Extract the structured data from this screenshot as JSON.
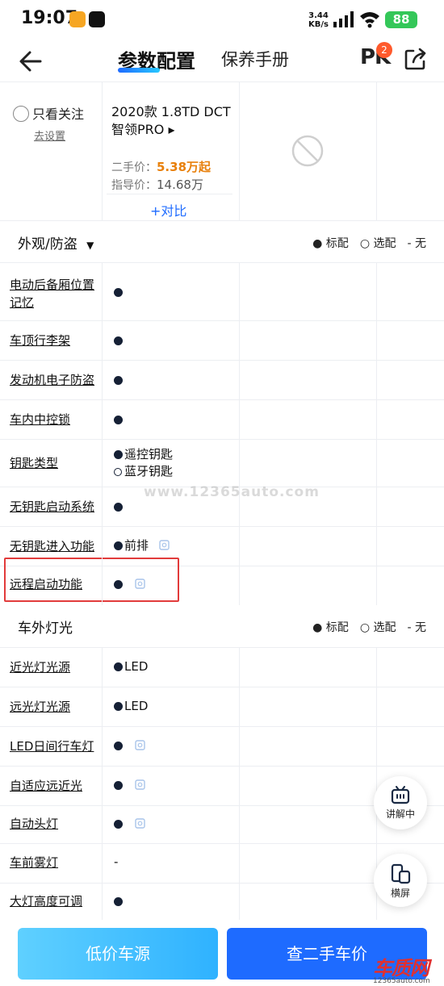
{
  "status": {
    "time": "19:07",
    "speed_value": "3.44",
    "speed_unit": "KB/s",
    "battery": "88"
  },
  "header": {
    "tab_active": "参数配置",
    "tab_inactive": "保养手册",
    "pk": "PK",
    "pk_badge": "2"
  },
  "car": {
    "follow_label": "只看关注",
    "follow_set": "去设置",
    "name": "2020款 1.8TD DCT 智领PRO ▸",
    "used_price_label": "二手价：",
    "used_price": "5.38万起",
    "guide_price_label": "指导价：",
    "guide_price": "14.68万",
    "compare": "+对比"
  },
  "legend": {
    "standard": "● 标配",
    "optional": "○ 选配",
    "none": "- 无"
  },
  "section1": {
    "title": "外观/防盗",
    "rows": [
      {
        "label": "电动后备厢位置记忆",
        "value": ""
      },
      {
        "label": "车顶行李架",
        "value": ""
      },
      {
        "label": "发动机电子防盗",
        "value": ""
      },
      {
        "label": "车内中控锁",
        "value": ""
      },
      {
        "label": "钥匙类型",
        "value1": "遥控钥匙",
        "value2": "蓝牙钥匙"
      },
      {
        "label": "无钥匙启动系统",
        "value": ""
      },
      {
        "label": "无钥匙进入功能",
        "value": "前排"
      },
      {
        "label": "远程启动功能",
        "value": ""
      }
    ]
  },
  "section2": {
    "title": "车外灯光",
    "rows": [
      {
        "label": "近光灯光源",
        "value": "LED"
      },
      {
        "label": "远光灯光源",
        "value": "LED"
      },
      {
        "label": "LED日间行车灯",
        "value": ""
      },
      {
        "label": "自适应远近光",
        "value": ""
      },
      {
        "label": "自动头灯",
        "value": ""
      },
      {
        "label": "车前雾灯",
        "value": "-"
      },
      {
        "label": "大灯高度可调",
        "value": ""
      }
    ]
  },
  "watermark": "www.12365auto.com",
  "floating": {
    "explain": "讲解中",
    "landscape": "横屏"
  },
  "bottom": {
    "btn_left": "低价车源",
    "btn_right": "查二手车价"
  },
  "logo": {
    "big": "车质网",
    "small": "12365auto.com"
  },
  "colors": {
    "accent": "#1e6bff",
    "price": "#e8800c",
    "highlight": "#e23b3b"
  }
}
